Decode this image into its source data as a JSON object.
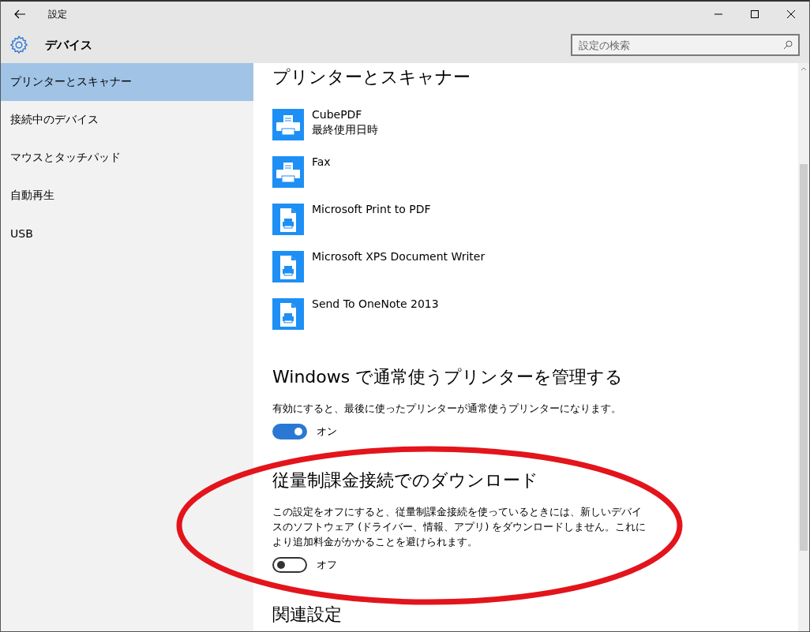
{
  "window": {
    "title": "設定"
  },
  "header": {
    "title": "デバイス",
    "search": {
      "placeholder": "設定の検索"
    }
  },
  "sidebar": {
    "items": [
      {
        "label": "プリンターとスキャナー",
        "selected": true
      },
      {
        "label": "接続中のデバイス",
        "selected": false
      },
      {
        "label": "マウスとタッチパッド",
        "selected": false
      },
      {
        "label": "自動再生",
        "selected": false
      },
      {
        "label": "USB",
        "selected": false
      }
    ]
  },
  "content": {
    "title": "プリンターとスキャナー",
    "printers": [
      {
        "name": "CubePDF",
        "detail": "最終使用日時",
        "kind": "printer"
      },
      {
        "name": "Fax",
        "kind": "printer"
      },
      {
        "name": "Microsoft Print to PDF",
        "kind": "document"
      },
      {
        "name": "Microsoft XPS Document Writer",
        "kind": "document"
      },
      {
        "name": "Send To OneNote 2013",
        "kind": "document"
      }
    ],
    "sections": [
      {
        "title": "Windows で通常使うプリンターを管理する",
        "description": "有効にすると、最後に使ったプリンターが通常使うプリンターになります。",
        "toggle": {
          "on": true,
          "label": "オン"
        }
      },
      {
        "title": "従量制課金接続でのダウンロード",
        "description": "この設定をオフにすると、従量制課金接続を使っているときには、新しいデバイスのソフトウェア (ドライバー、情報、アプリ) をダウンロードしません。これにより追加料金がかかることを避けられます。",
        "toggle": {
          "on": false,
          "label": "オフ"
        },
        "highlighted": true
      },
      {
        "title": "関連設定"
      }
    ]
  }
}
